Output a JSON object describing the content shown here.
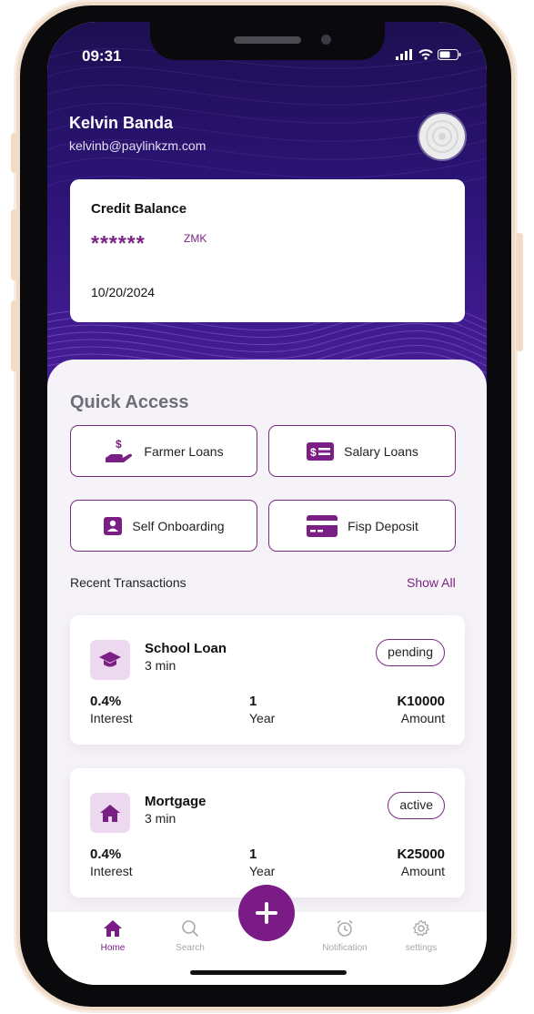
{
  "status_bar": {
    "time": "09:31"
  },
  "user": {
    "name": "Kelvin Banda",
    "email": "kelvinb@paylinkzm.com"
  },
  "credit": {
    "title": "Credit Balance",
    "amount": "******",
    "currency": "ZMK",
    "date": "10/20/2024"
  },
  "quick_access": {
    "title": "Quick Access",
    "items": [
      {
        "label": "Farmer Loans",
        "icon": "hand-dollar-icon"
      },
      {
        "label": "Salary Loans",
        "icon": "dollar-bill-icon"
      },
      {
        "label": "Self Onboarding",
        "icon": "user-badge-icon"
      },
      {
        "label": "Fisp Deposit",
        "icon": "credit-card-icon"
      }
    ]
  },
  "recent": {
    "title": "Recent Transactions",
    "show_all": "Show All",
    "items": [
      {
        "title": "School Loan",
        "time": "3 min",
        "status": "pending",
        "icon": "graduation-cap-icon",
        "interest": "0.4%",
        "interest_label": "Interest",
        "term": "1",
        "term_label": "Year",
        "amount": "K10000",
        "amount_label": "Amount"
      },
      {
        "title": "Mortgage",
        "time": "3 min",
        "status": "active",
        "icon": "house-icon",
        "interest": "0.4%",
        "interest_label": "Interest",
        "term": "1",
        "term_label": "Year",
        "amount": "K25000",
        "amount_label": "Amount"
      }
    ]
  },
  "nav": {
    "items": [
      {
        "label": "Home",
        "icon": "home-icon",
        "active": true
      },
      {
        "label": "Search",
        "icon": "search-icon"
      },
      {
        "label": "Notification",
        "icon": "alarm-clock-icon"
      },
      {
        "label": "settings",
        "icon": "gear-icon"
      }
    ],
    "fab_icon": "plus-icon"
  },
  "colors": {
    "accent": "#7b1b85",
    "header": "#2c1477",
    "background": "#f6f3f8",
    "inactive": "#a7a7ad"
  }
}
